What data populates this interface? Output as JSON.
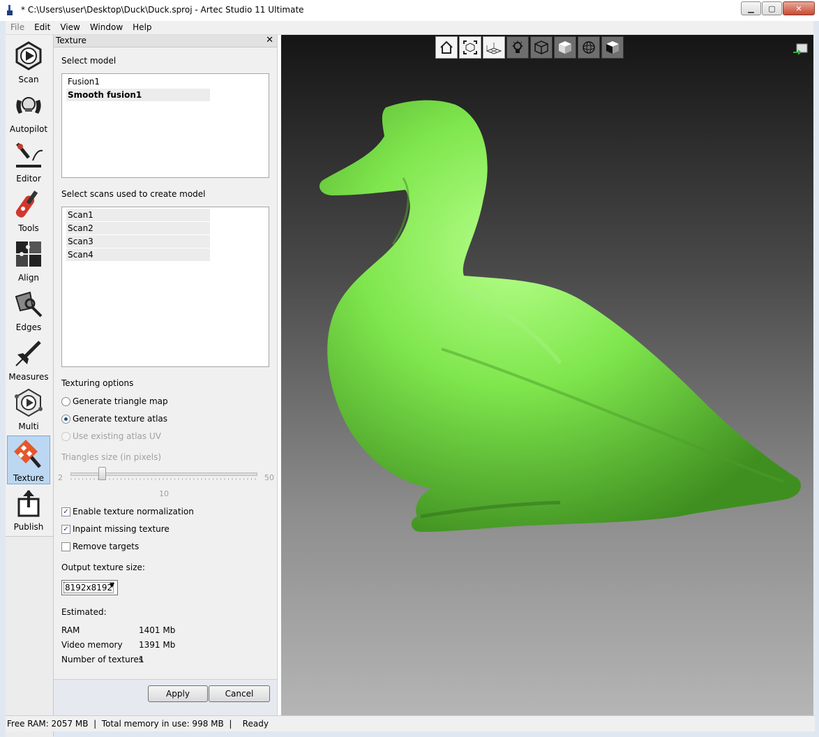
{
  "window": {
    "title": "* C:\\Users\\user\\Desktop\\Duck\\Duck.sproj - Artec Studio 11 Ultimate"
  },
  "menu": {
    "items": [
      "File",
      "Edit",
      "View",
      "Window",
      "Help"
    ]
  },
  "nav": {
    "items": [
      {
        "label": "Scan",
        "icon": "scan-icon"
      },
      {
        "label": "Autopilot",
        "icon": "autopilot-icon"
      },
      {
        "label": "Editor",
        "icon": "editor-icon"
      },
      {
        "label": "Tools",
        "icon": "tools-icon"
      },
      {
        "label": "Align",
        "icon": "align-icon"
      },
      {
        "label": "Edges",
        "icon": "edges-icon"
      },
      {
        "label": "Measures",
        "icon": "measures-icon"
      },
      {
        "label": "Multi",
        "icon": "multi-icon"
      },
      {
        "label": "Texture",
        "icon": "texture-icon"
      },
      {
        "label": "Publish",
        "icon": "publish-icon"
      }
    ],
    "active": "Texture"
  },
  "panel": {
    "title": "Texture",
    "close": "✕",
    "select_model_label": "Select model",
    "models": [
      {
        "name": "Fusion1",
        "selected": false
      },
      {
        "name": "Smooth fusion1",
        "selected": true
      }
    ],
    "select_scans_label": "Select scans used to create model",
    "scans": [
      "Scan1",
      "Scan2",
      "Scan3",
      "Scan4"
    ],
    "texturing_options_label": "Texturing options",
    "options": [
      {
        "label": "Generate triangle map",
        "checked": false,
        "enabled": true
      },
      {
        "label": "Generate texture atlas",
        "checked": true,
        "enabled": true
      },
      {
        "label": "Use existing atlas UV",
        "checked": false,
        "enabled": false
      }
    ],
    "triangle_size_label": "Triangles size (in pixels)",
    "slider": {
      "min": "2",
      "max": "50",
      "value": "10",
      "fraction": 0.17
    },
    "checkboxes": [
      {
        "label": "Enable texture normalization",
        "checked": true
      },
      {
        "label": "Inpaint missing texture",
        "checked": true
      },
      {
        "label": "Remove targets",
        "checked": false
      }
    ],
    "output_size_label": "Output texture size:",
    "output_size_value": "8192x8192",
    "estimated_label": "Estimated:",
    "estimates": [
      {
        "label": "RAM",
        "value": "1401 Mb"
      },
      {
        "label": "Video memory",
        "value": "1391 Mb"
      },
      {
        "label": "Number of textures",
        "value": "1"
      }
    ],
    "apply_label": "Apply",
    "cancel_label": "Cancel"
  },
  "viewport": {
    "toolbar": [
      "home-icon",
      "fit-view-icon",
      "grid-icon",
      "lighting-icon",
      "wireframe-cube-icon",
      "shaded-cube-icon",
      "sphere-icon",
      "textured-cube-icon"
    ],
    "model_color": "#7fe64d"
  },
  "status": {
    "text": "Free RAM: 2057 MB  |  Total memory in use: 998 MB  |    Ready"
  }
}
